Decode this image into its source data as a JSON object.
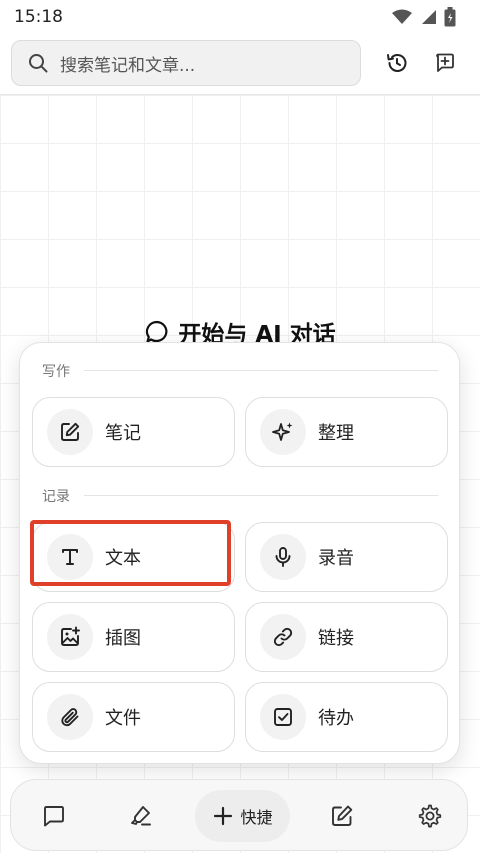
{
  "status_bar": {
    "time": "15:18"
  },
  "search": {
    "placeholder": "搜索笔记和文章..."
  },
  "main": {
    "heading": "开始与 AI 对话"
  },
  "popup": {
    "sections": [
      {
        "label": "写作",
        "items": [
          {
            "label": "笔记",
            "icon": "edit-note-icon"
          },
          {
            "label": "整理",
            "icon": "sparkle-icon"
          }
        ]
      },
      {
        "label": "记录",
        "items": [
          {
            "label": "文本",
            "icon": "text-icon"
          },
          {
            "label": "录音",
            "icon": "microphone-icon"
          },
          {
            "label": "插图",
            "icon": "image-add-icon"
          },
          {
            "label": "链接",
            "icon": "link-icon"
          },
          {
            "label": "文件",
            "icon": "paperclip-icon"
          },
          {
            "label": "待办",
            "icon": "checkbox-icon"
          }
        ]
      }
    ]
  },
  "bottom_bar": {
    "quick_label": "快捷"
  },
  "colors": {
    "highlight": "#e0402a",
    "accent_text": "#1f1f1f"
  }
}
